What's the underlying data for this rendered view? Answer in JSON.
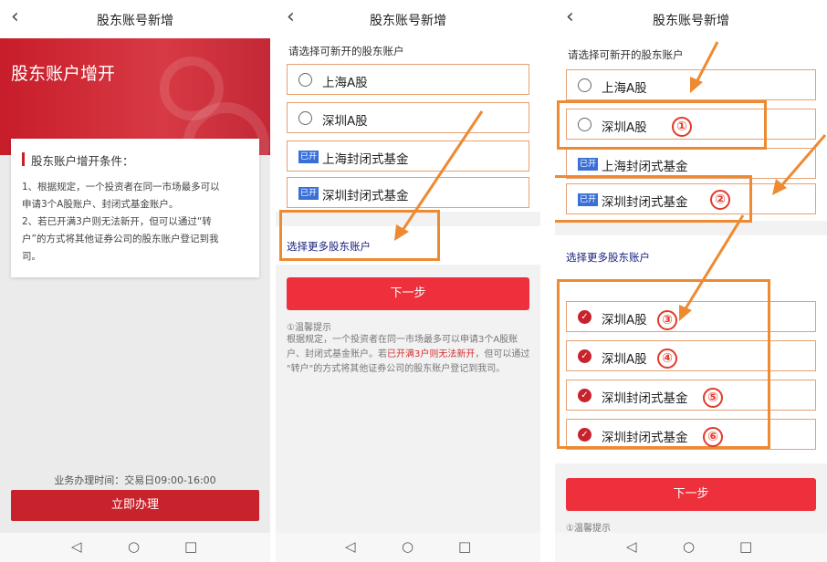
{
  "panel1": {
    "header_title": "股东账号新增",
    "banner_title": "股东账户增开",
    "conditions": {
      "title": "股东账户增开条件：",
      "lines": [
        "1、根据规定，一个投资者在同一市场最多可以",
        "申请3个A股账户、封闭式基金账户。",
        "2、若已开满3户则无法新开，但可以通过“转",
        "户”的方式将其他证券公司的股东账户登记到我",
        "司。"
      ]
    },
    "hours": "业务办理时间：交易日09:00-16:00",
    "apply_button": "立即办理"
  },
  "panel2": {
    "header_title": "股东账号新增",
    "prompt": "请选择可新开的股东账户",
    "options": [
      {
        "label": "上海A股",
        "state": "radio"
      },
      {
        "label": "深圳A股",
        "state": "radio"
      },
      {
        "label": "上海封闭式基金",
        "state": "opened",
        "tag": "已开"
      },
      {
        "label": "深圳封闭式基金",
        "state": "opened",
        "tag": "已开"
      }
    ],
    "more_link": "选择更多股东账户",
    "next_button": "下一步",
    "tip_title": "①温馨提示",
    "tip_lines": [
      "根据规定，一个投资者在同一市场最多可以申请3个A股账",
      "户、封闭式基金账户。若",
      "已开满3户则无法新开",
      "，但可以通过",
      "\"转户\"的方式将其他证券公司的股东账户登记到我司。"
    ]
  },
  "panel3": {
    "header_title": "股东账号新增",
    "prompt": "请选择可新开的股东账户",
    "options": [
      {
        "label": "上海A股",
        "state": "radio"
      },
      {
        "label": "深圳A股",
        "state": "radio"
      },
      {
        "label": "上海封闭式基金",
        "state": "opened",
        "tag": "已开"
      },
      {
        "label": "深圳封闭式基金",
        "state": "opened",
        "tag": "已开"
      }
    ],
    "more_link": "选择更多股东账户",
    "more_options": [
      {
        "label": "深圳A股",
        "state": "checked"
      },
      {
        "label": "深圳A股",
        "state": "checked"
      },
      {
        "label": "深圳封闭式基金",
        "state": "checked"
      },
      {
        "label": "深圳封闭式基金",
        "state": "checked"
      }
    ],
    "next_button": "下一步",
    "tip_title": "①温馨提示",
    "annotations": [
      "①",
      "②",
      "③",
      "④",
      "⑤",
      "⑥"
    ]
  },
  "icons": {
    "back": "‹",
    "check": "✓",
    "nav_back": "◁",
    "nav_home": "○",
    "nav_recent": "□"
  },
  "colors": {
    "brand_red": "#c8232c",
    "annotation_orange": "#ee8a32",
    "opened_tag_blue": "#3a6fd8"
  }
}
